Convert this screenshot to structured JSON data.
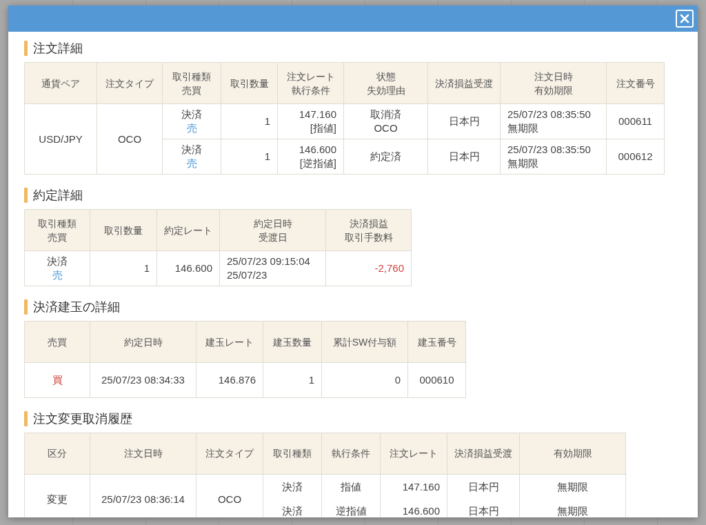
{
  "sections": [
    {
      "title": "注文詳細",
      "table": {
        "columns": [
          {
            "lines": [
              "通貨ペア"
            ]
          },
          {
            "lines": [
              "注文タイプ"
            ]
          },
          {
            "lines": [
              "取引種類",
              "売買"
            ]
          },
          {
            "lines": [
              "取引数量"
            ]
          },
          {
            "lines": [
              "注文レート",
              "執行条件"
            ]
          },
          {
            "lines": [
              "状態",
              "失効理由"
            ]
          },
          {
            "lines": [
              "決済損益受渡"
            ]
          },
          {
            "lines": [
              "注文日時",
              "有効期限"
            ]
          },
          {
            "lines": [
              "注文番号"
            ]
          }
        ],
        "rows": [
          {
            "cells": [
              {
                "lines": [
                  "USD/JPY"
                ],
                "rowspan": 2
              },
              {
                "lines": [
                  "OCO"
                ],
                "rowspan": 2
              },
              {
                "lines": [
                  "決済",
                  {
                    "text": "売",
                    "color": "#3d8fd6"
                  }
                ]
              },
              {
                "lines": [
                  "1"
                ]
              },
              {
                "lines": [
                  "147.160",
                  "[指値]"
                ]
              },
              {
                "lines": [
                  "取消済",
                  "OCO"
                ]
              },
              {
                "lines": [
                  "日本円"
                ]
              },
              {
                "lines": [
                  "25/07/23 08:35:50",
                  "無期限"
                ]
              },
              {
                "lines": [
                  "000611"
                ]
              }
            ]
          },
          {
            "cells": [
              {
                "lines": [
                  "決済",
                  {
                    "text": "売",
                    "color": "#3d8fd6"
                  }
                ]
              },
              {
                "lines": [
                  "1"
                ]
              },
              {
                "lines": [
                  "146.600",
                  "[逆指値]"
                ]
              },
              {
                "lines": [
                  "約定済"
                ]
              },
              {
                "lines": [
                  "日本円"
                ]
              },
              {
                "lines": [
                  "25/07/23 08:35:50",
                  "無期限"
                ]
              },
              {
                "lines": [
                  "000612"
                ]
              }
            ]
          }
        ]
      }
    },
    {
      "title": "約定詳細",
      "table": {
        "columns": [
          {
            "lines": [
              "取引種類",
              "売買"
            ]
          },
          {
            "lines": [
              "取引数量"
            ]
          },
          {
            "lines": [
              "約定レート"
            ]
          },
          {
            "lines": [
              "約定日時",
              "受渡日"
            ]
          },
          {
            "lines": [
              "決済損益",
              "取引手数料"
            ]
          }
        ],
        "rows": [
          {
            "cells": [
              {
                "lines": [
                  "決済",
                  {
                    "text": "売",
                    "color": "#3d8fd6"
                  }
                ]
              },
              {
                "lines": [
                  "1"
                ]
              },
              {
                "lines": [
                  "146.600"
                ]
              },
              {
                "lines": [
                  "25/07/23 09:15:04",
                  "25/07/23"
                ]
              },
              {
                "lines": [
                  {
                    "text": "-2,760",
                    "color": "#d0433a"
                  }
                ]
              }
            ]
          }
        ]
      }
    },
    {
      "title": "決済建玉の詳細",
      "table": {
        "columns": [
          {
            "lines": [
              "売買"
            ]
          },
          {
            "lines": [
              "約定日時"
            ]
          },
          {
            "lines": [
              "建玉レート"
            ]
          },
          {
            "lines": [
              "建玉数量"
            ]
          },
          {
            "lines": [
              "累計SW付与額"
            ]
          },
          {
            "lines": [
              "建玉番号"
            ]
          }
        ],
        "rows": [
          {
            "cells": [
              {
                "lines": [
                  {
                    "text": "買",
                    "color": "#d0433a"
                  }
                ]
              },
              {
                "lines": [
                  "25/07/23 08:34:33"
                ]
              },
              {
                "lines": [
                  "146.876"
                ]
              },
              {
                "lines": [
                  "1"
                ]
              },
              {
                "lines": [
                  "0"
                ]
              },
              {
                "lines": [
                  "000610"
                ]
              }
            ]
          }
        ]
      }
    },
    {
      "title": "注文変更取消履歴",
      "table": {
        "columns": [
          {
            "lines": [
              "区分"
            ]
          },
          {
            "lines": [
              "注文日時"
            ]
          },
          {
            "lines": [
              "注文タイプ"
            ]
          },
          {
            "lines": [
              "取引種類"
            ]
          },
          {
            "lines": [
              "執行条件"
            ]
          },
          {
            "lines": [
              "注文レート"
            ]
          },
          {
            "lines": [
              "決済損益受渡"
            ]
          },
          {
            "lines": [
              "有効期限"
            ]
          }
        ],
        "rows": [
          {
            "cells": [
              {
                "lines": [
                  "変更"
                ]
              },
              {
                "lines": [
                  "25/07/23 08:36:14"
                ]
              },
              {
                "lines": [
                  "OCO"
                ]
              },
              {
                "lines": [
                  "決済",
                  "決済"
                ]
              },
              {
                "lines": [
                  "指値",
                  "逆指値"
                ]
              },
              {
                "lines": [
                  "147.160",
                  "146.600"
                ]
              },
              {
                "lines": [
                  "日本円",
                  "日本円"
                ]
              },
              {
                "lines": [
                  "無期限",
                  "無期限"
                ]
              }
            ]
          }
        ]
      }
    }
  ]
}
